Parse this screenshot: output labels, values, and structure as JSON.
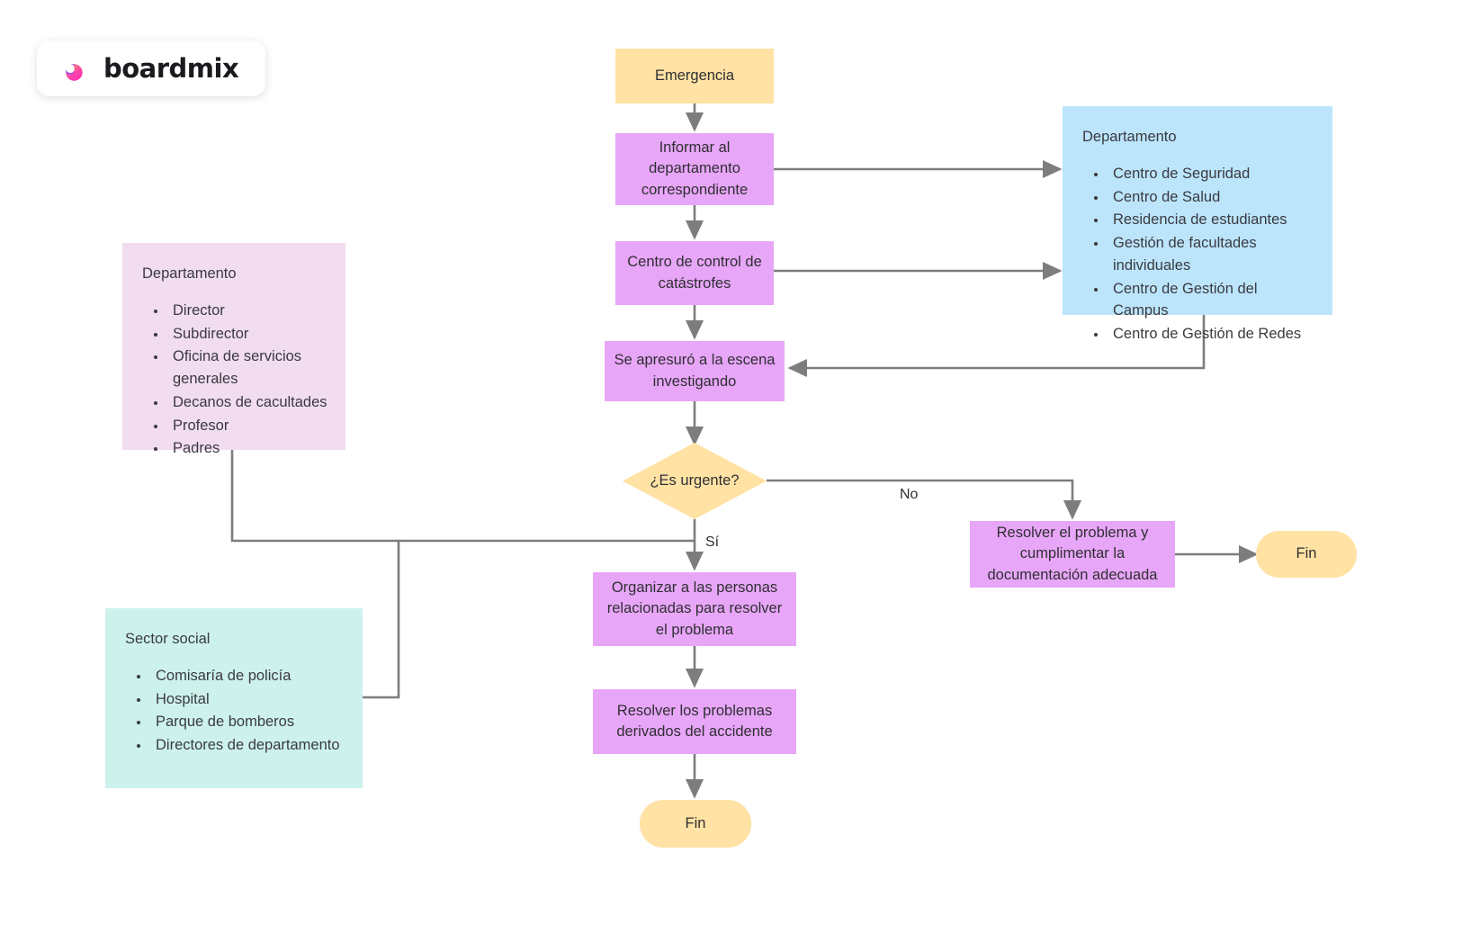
{
  "logo": {
    "brand": "boardmix",
    "icon": "boardmix-b-icon"
  },
  "colors": {
    "orange": "#FFE2A4",
    "purple": "#E8A6F8",
    "panel_pink": "#F2DCF0",
    "panel_blue": "#BCE5FC",
    "panel_teal": "#CDF2EC",
    "connector": "#7d7d7d",
    "text": "#2f2f33"
  },
  "nodes": {
    "start": "Emergencia",
    "inform": "Informar al departamento correspondiente",
    "control_center": "Centro de control de catástrofes",
    "scene": "Se apresuró a la escena investigando",
    "decision": "¿Es urgente?",
    "organize": "Organizar a las personas relacionadas para resolver el problema",
    "solve_derived": "Resolver los problemas derivados del accidente",
    "end_main": "Fin",
    "solve_document": "Resolver el problema y cumplimentar la documentación adecuada",
    "end_no": "Fin"
  },
  "edge_labels": {
    "yes": "Sí",
    "no": "No"
  },
  "panels": {
    "department_right": {
      "title": "Departamento",
      "items": [
        "Centro de Seguridad",
        "Centro de Salud",
        "Residencia de estudiantes",
        "Gestión de facultades individuales",
        "Centro de Gestión del Campus",
        "Centro de Gestión de Redes"
      ]
    },
    "department_left": {
      "title": "Departamento",
      "items": [
        "Director",
        "Subdirector",
        "Oficina de servicios generales",
        "Decanos de cacultades",
        "Profesor",
        "Padres"
      ]
    },
    "social_sector": {
      "title": "Sector social",
      "items": [
        "Comisaría de policía",
        "Hospital",
        "Parque de bomberos",
        "Directores de departamento"
      ]
    }
  }
}
